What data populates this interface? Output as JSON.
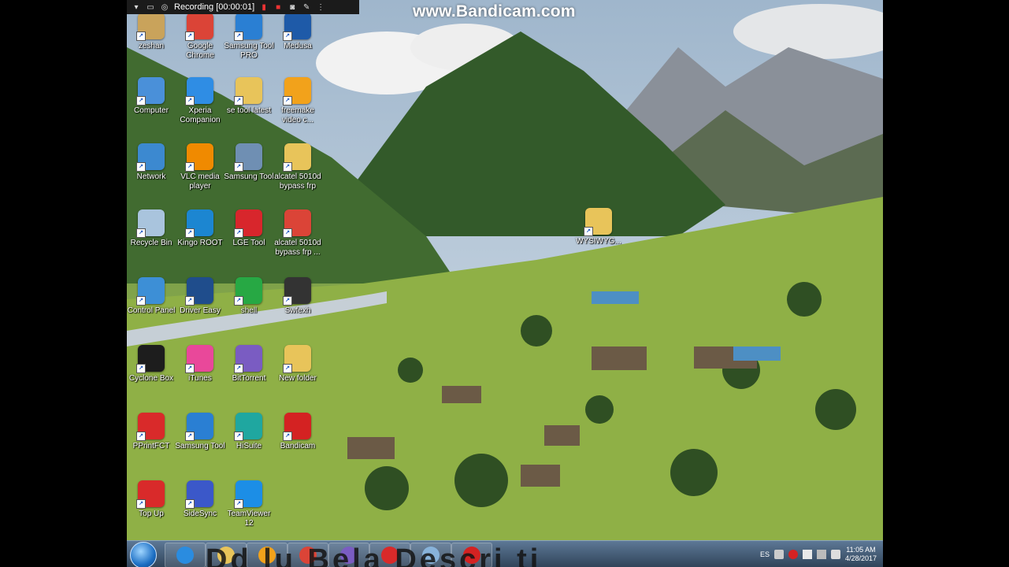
{
  "recorder": {
    "status": "Recording [00:00:01]",
    "watermark": "www.Bandicam.com"
  },
  "desktop": {
    "icons": [
      {
        "label": "zeshan",
        "icon": "user-folder-icon",
        "color": "#c9a35b"
      },
      {
        "label": "Google Chrome",
        "icon": "chrome-icon",
        "color": "#db4437"
      },
      {
        "label": "Samsung Tool PRO",
        "icon": "samsung-tool-icon",
        "color": "#2a7fd3"
      },
      {
        "label": "Medusa",
        "icon": "medusa-icon",
        "color": "#1e5aa8"
      },
      {
        "label": "Computer",
        "icon": "computer-icon",
        "color": "#4a90d9"
      },
      {
        "label": "Xperia Companion",
        "icon": "xperia-icon",
        "color": "#2f8de4"
      },
      {
        "label": "se tool latest",
        "icon": "folder-icon",
        "color": "#e8c45a"
      },
      {
        "label": "freemake video c...",
        "icon": "freemake-icon",
        "color": "#f2a21b"
      },
      {
        "label": "Network",
        "icon": "network-icon",
        "color": "#3c89d0"
      },
      {
        "label": "VLC media player",
        "icon": "vlc-icon",
        "color": "#f08a00"
      },
      {
        "label": "Samsung Tool",
        "icon": "gear-icon",
        "color": "#6f8fb3"
      },
      {
        "label": "alcatel 5010d bypass frp",
        "icon": "folder-icon",
        "color": "#e8c45a"
      },
      {
        "label": "Recycle Bin",
        "icon": "recycle-bin-icon",
        "color": "#a9c4dd"
      },
      {
        "label": "Kingo ROOT",
        "icon": "kingo-root-icon",
        "color": "#1c86d1"
      },
      {
        "label": "LGE Tool",
        "icon": "lge-tool-icon",
        "color": "#d8262c"
      },
      {
        "label": "alcatel 5010d bypass frp ...",
        "icon": "chrome-icon",
        "color": "#db4437"
      },
      {
        "label": "Control Panel",
        "icon": "control-panel-icon",
        "color": "#3d8fd6"
      },
      {
        "label": "Driver Easy",
        "icon": "driver-easy-icon",
        "color": "#1f4d8c"
      },
      {
        "label": "shell",
        "icon": "shell-icon",
        "color": "#27a844"
      },
      {
        "label": "Swfexh",
        "icon": "phone-icon",
        "color": "#333333"
      },
      {
        "label": "Cyclone Box",
        "icon": "cyclone-box-icon",
        "color": "#1d1d1d"
      },
      {
        "label": "iTunes",
        "icon": "itunes-icon",
        "color": "#e9489a"
      },
      {
        "label": "BitTorrent",
        "icon": "bittorrent-icon",
        "color": "#7a5cc2"
      },
      {
        "label": "New folder",
        "icon": "folder-icon",
        "color": "#e8c45a"
      },
      {
        "label": "PPrintFCT",
        "icon": "acrobat-icon",
        "color": "#d92a2a"
      },
      {
        "label": "Samsung Tool",
        "icon": "samsung-tool-icon",
        "color": "#2a7fd3"
      },
      {
        "label": "HiSuite",
        "icon": "hisuite-icon",
        "color": "#1fa7a0"
      },
      {
        "label": "Bandicam",
        "icon": "bandicam-icon",
        "color": "#d42222"
      },
      {
        "label": "Top Up",
        "icon": "acrobat-icon",
        "color": "#d92a2a"
      },
      {
        "label": "SideSync",
        "icon": "sidesync-icon",
        "color": "#3b58c9"
      },
      {
        "label": "TeamViewer 12",
        "icon": "teamviewer-icon",
        "color": "#1c8ee6"
      },
      {
        "label": "WYSIWYG...",
        "icon": "folder-icon",
        "color": "#e8c45a"
      }
    ]
  },
  "taskbar": {
    "items": [
      {
        "name": "internet-explorer",
        "color": "#2a8ce0"
      },
      {
        "name": "file-explorer",
        "color": "#e8c45a"
      },
      {
        "name": "media-player",
        "color": "#f2a21b"
      },
      {
        "name": "chrome",
        "color": "#db4437"
      },
      {
        "name": "bittorrent",
        "color": "#7a5cc2"
      },
      {
        "name": "acrobat",
        "color": "#d92a2a"
      },
      {
        "name": "window",
        "color": "#88b3da"
      },
      {
        "name": "bandicam",
        "color": "#d42222"
      }
    ],
    "language": "ES",
    "time": "11:05 AM",
    "date": "4/28/2017"
  },
  "overlay": {
    "text": "Dd  lu  Bela  Descri  ti"
  }
}
